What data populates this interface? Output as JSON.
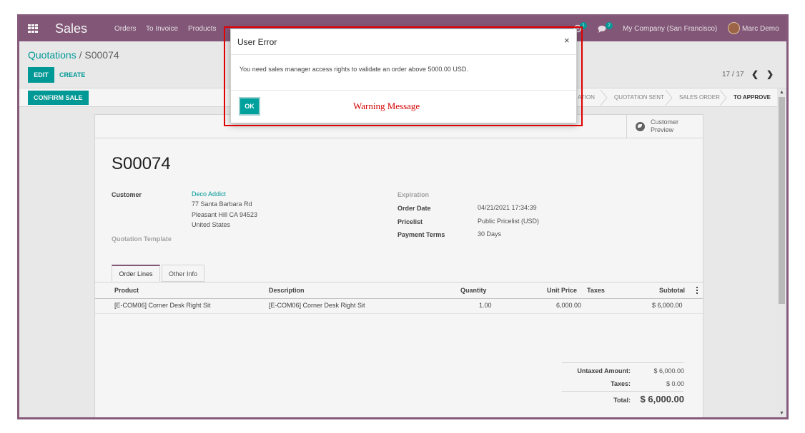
{
  "navbar": {
    "app_title": "Sales",
    "menu": [
      "Orders",
      "To Invoice",
      "Products"
    ],
    "activity_count": "1",
    "messages_count": "2",
    "company": "My Company (San Francisco)",
    "user": "Marc Demo"
  },
  "breadcrumb": {
    "parent": "Quotations",
    "separator": " / ",
    "current": "S00074"
  },
  "buttons": {
    "edit": "EDIT",
    "create": "CREATE",
    "confirm_sale": "CONFIRM SALE"
  },
  "pager": {
    "value": "17 / 17"
  },
  "statusbar": {
    "stages": [
      "QUOTATION",
      "QUOTATION SENT",
      "SALES ORDER",
      "TO APPROVE"
    ],
    "visible_partial_first": "ATION",
    "active": "TO APPROVE"
  },
  "sheet": {
    "preview_button": "Customer\nPreview",
    "order_name": "S00074",
    "customer_label": "Customer",
    "customer_name": "Deco Addict",
    "address_line1": "77 Santa Barbara Rd",
    "address_line2": "Pleasant Hill CA 94523",
    "address_line3": "United States",
    "template_label": "Quotation Template",
    "expiration_label": "Expiration",
    "order_date_label": "Order Date",
    "order_date": "04/21/2021 17:34:39",
    "pricelist_label": "Pricelist",
    "pricelist": "Public Pricelist (USD)",
    "payment_terms_label": "Payment Terms",
    "payment_terms": "30 Days"
  },
  "tabs": {
    "order_lines": "Order Lines",
    "other_info": "Other Info"
  },
  "table": {
    "headers": {
      "product": "Product",
      "description": "Description",
      "quantity": "Quantity",
      "unit_price": "Unit Price",
      "taxes": "Taxes",
      "subtotal": "Subtotal"
    },
    "rows": [
      {
        "product": "[E-COM06] Corner Desk Right Sit",
        "description": "[E-COM06] Corner Desk Right Sit",
        "quantity": "1.00",
        "unit_price": "6,000.00",
        "taxes": "",
        "subtotal": "$ 6,000.00"
      }
    ]
  },
  "totals": {
    "untaxed_label": "Untaxed Amount:",
    "untaxed": "$ 6,000.00",
    "taxes_label": "Taxes:",
    "taxes": "$ 0.00",
    "total_label": "Total:",
    "total": "$ 6,000.00"
  },
  "modal": {
    "title": "User Error",
    "close": "×",
    "message": "You need sales manager access rights to validate an order above 5000.00 USD.",
    "ok": "OK"
  },
  "annotation": {
    "text": "Warning Message"
  },
  "colors": {
    "brand": "#875a7b",
    "accent": "#00a09d",
    "annotation": "#e00000"
  },
  "icons": [
    "apps-icon",
    "activity-icon",
    "chat-icon",
    "globe-icon",
    "chevron-left-icon",
    "chevron-right-icon",
    "close-icon",
    "kebab-icon"
  ]
}
